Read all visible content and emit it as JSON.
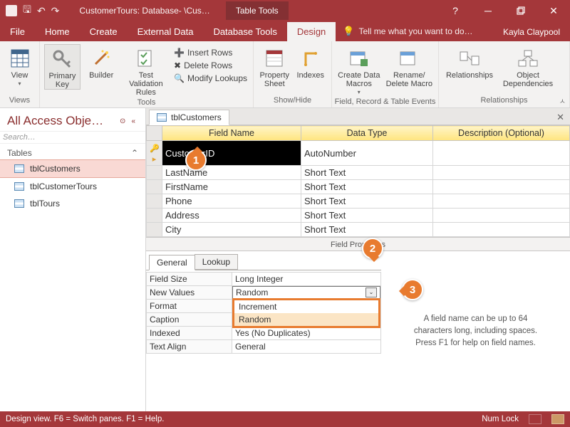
{
  "titlebar": {
    "title": "CustomerTours: Database- \\Cus…",
    "context_tab": "Table Tools"
  },
  "ribbon_tabs": {
    "file": "File",
    "home": "Home",
    "create": "Create",
    "external": "External Data",
    "dbtools": "Database Tools",
    "design": "Design",
    "tellme": "Tell me what you want to do…",
    "user": "Kayla Claypool"
  },
  "ribbon": {
    "views": {
      "view": "View",
      "group": "Views"
    },
    "tools": {
      "primary_key": "Primary Key",
      "builder": "Builder",
      "test_rules": "Test Validation Rules",
      "insert_rows": "Insert Rows",
      "delete_rows": "Delete Rows",
      "modify_lookups": "Modify Lookups",
      "group": "Tools"
    },
    "showhide": {
      "property_sheet": "Property Sheet",
      "indexes": "Indexes",
      "group": "Show/Hide"
    },
    "events": {
      "create_macros": "Create Data Macros",
      "delete_macro": "Rename/ Delete Macro",
      "group": "Field, Record & Table Events"
    },
    "rel": {
      "relationships": "Relationships",
      "obj_dep": "Object Dependencies",
      "group": "Relationships"
    }
  },
  "nav": {
    "header": "All Access Obje…",
    "search": "Search…",
    "group": "Tables",
    "items": [
      "tblCustomers",
      "tblCustomerTours",
      "tblTours"
    ]
  },
  "design": {
    "tab": "tblCustomers",
    "headers": {
      "field": "Field Name",
      "type": "Data Type",
      "desc": "Description (Optional)"
    },
    "rows": [
      {
        "pk": true,
        "name": "CustomerID",
        "type": "AutoNumber"
      },
      {
        "name": "LastName",
        "type": "Short Text"
      },
      {
        "name": "FirstName",
        "type": "Short Text"
      },
      {
        "name": "Phone",
        "type": "Short Text"
      },
      {
        "name": "Address",
        "type": "Short Text"
      },
      {
        "name": "City",
        "type": "Short Text"
      }
    ],
    "props_label": "Field Properties",
    "prop_tabs": {
      "general": "General",
      "lookup": "Lookup"
    },
    "props": {
      "field_size": {
        "label": "Field Size",
        "value": "Long Integer"
      },
      "new_values": {
        "label": "New Values",
        "value": "Random",
        "options": [
          "Increment",
          "Random"
        ]
      },
      "format": {
        "label": "Format",
        "value": ""
      },
      "caption": {
        "label": "Caption",
        "value": ""
      },
      "indexed": {
        "label": "Indexed",
        "value": "Yes (No Duplicates)"
      },
      "text_align": {
        "label": "Text Align",
        "value": "General"
      }
    },
    "help": "A field name can be up to 64 characters long, including spaces. Press F1 for help on field names."
  },
  "status": {
    "left": "Design view.   F6 = Switch panes.   F1 = Help.",
    "numlock": "Num Lock"
  },
  "callouts": {
    "1": "1",
    "2": "2",
    "3": "3"
  }
}
